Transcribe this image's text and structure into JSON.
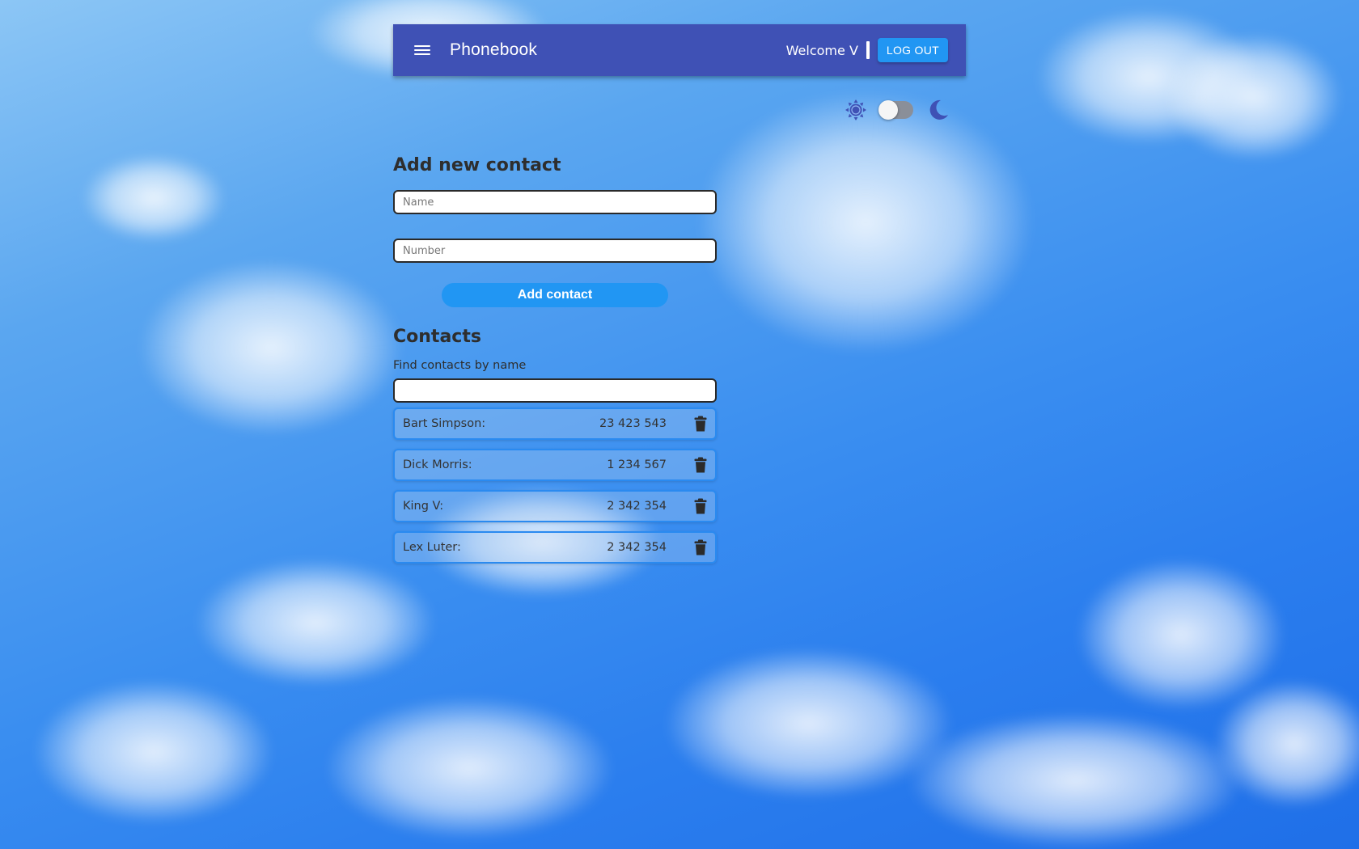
{
  "appbar": {
    "title": "Phonebook",
    "welcome": "Welcome V",
    "logout_label": "LOG OUT",
    "color": "#3f51b5"
  },
  "theme": {
    "sun_icon": "sun-icon",
    "moon_icon": "moon-icon",
    "dark_mode": false
  },
  "form": {
    "title": "Add new contact",
    "name_placeholder": "Name",
    "name_value": "",
    "number_placeholder": "Number",
    "number_value": "",
    "submit_label": "Add contact"
  },
  "contacts": {
    "title": "Contacts",
    "filter_label": "Find contacts by name",
    "filter_value": "",
    "items": [
      {
        "name": "Bart Simpson:",
        "number": "23 423 543"
      },
      {
        "name": "Dick Morris:",
        "number": "1 234 567"
      },
      {
        "name": "King V:",
        "number": "2 342 354"
      },
      {
        "name": "Lex Luter:",
        "number": "2 342 354"
      }
    ]
  },
  "colors": {
    "accent": "#2196f3",
    "item_border": "#2a8af0",
    "icon": "#3f51b5"
  }
}
